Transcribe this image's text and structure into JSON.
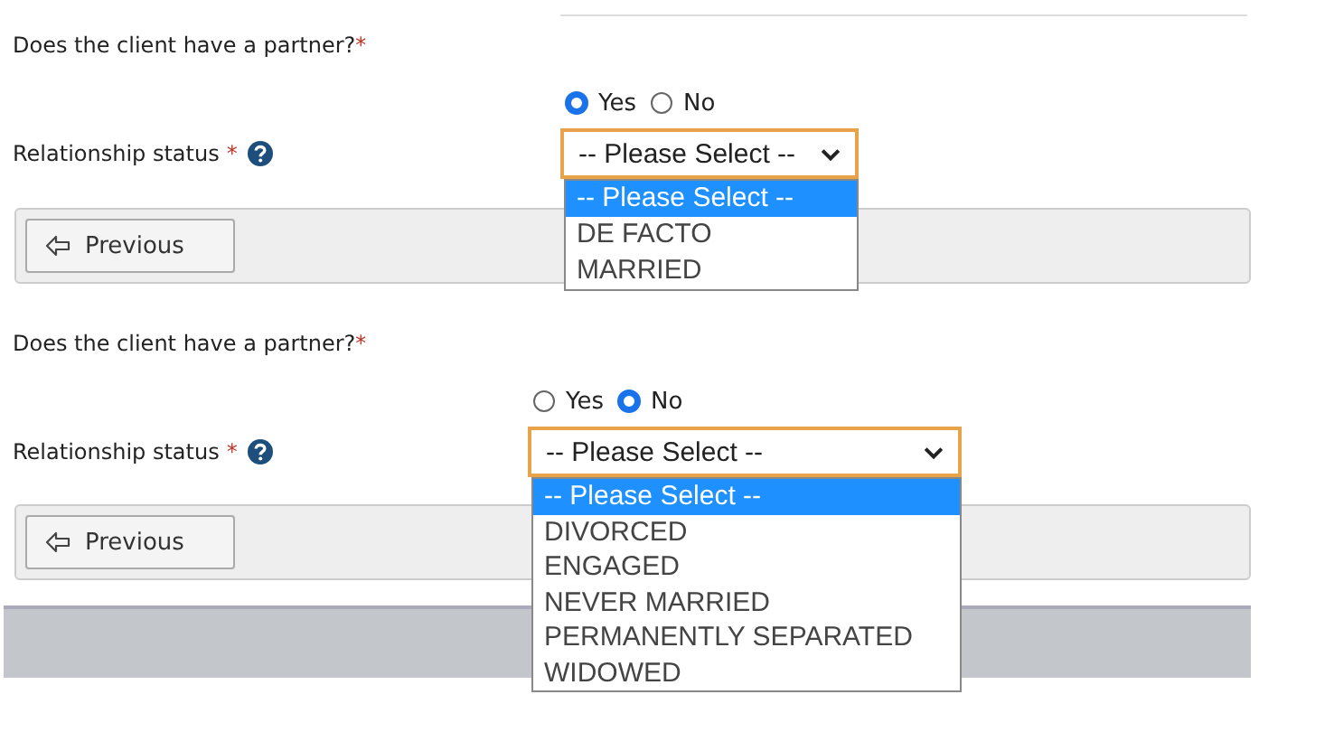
{
  "sections": [
    {
      "question": "Does the client have a partner?",
      "required_mark": "*",
      "radios": [
        {
          "label": "Yes",
          "selected": true
        },
        {
          "label": "No",
          "selected": false
        }
      ],
      "status_label": "Relationship status",
      "status_required_mark": "*",
      "select_value": "-- Please Select --",
      "dropdown_open": true,
      "options": [
        {
          "label": "-- Please Select --",
          "selected": true
        },
        {
          "label": "DE FACTO",
          "selected": false
        },
        {
          "label": "MARRIED",
          "selected": false
        }
      ],
      "previous_label": "Previous"
    },
    {
      "question": "Does the client have a partner?",
      "required_mark": "*",
      "radios": [
        {
          "label": "Yes",
          "selected": false
        },
        {
          "label": "No",
          "selected": true
        }
      ],
      "status_label": "Relationship status",
      "status_required_mark": "*",
      "select_value": "-- Please Select --",
      "dropdown_open": true,
      "options": [
        {
          "label": "-- Please Select --",
          "selected": true
        },
        {
          "label": "DIVORCED",
          "selected": false
        },
        {
          "label": "ENGAGED",
          "selected": false
        },
        {
          "label": "NEVER MARRIED",
          "selected": false
        },
        {
          "label": "PERMANENTLY SEPARATED",
          "selected": false
        },
        {
          "label": "WIDOWED",
          "selected": false
        }
      ],
      "previous_label": "Previous"
    }
  ]
}
